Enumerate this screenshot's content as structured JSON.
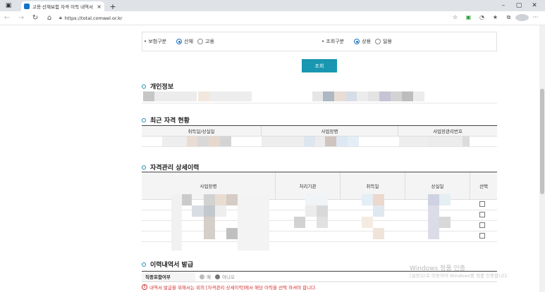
{
  "browser": {
    "tab_title": "고용·산재보험 자격 이력 내역서",
    "tab_close": "×",
    "new_tab": "+",
    "url": "https://total.comwel.or.kr",
    "win_controls": [
      "–",
      "▢",
      "✕"
    ],
    "icons": [
      "sidebar-icon",
      "back-icon",
      "forward-icon",
      "refresh-icon",
      "home-icon",
      "lock-icon",
      "favorite-add-icon",
      "extension-icon",
      "collections-icon",
      "favorites-icon",
      "browser-profile-icon",
      "more-icon"
    ]
  },
  "filters": {
    "insurance_label": "• 보험구분",
    "insurance_options": [
      "산재",
      "고용"
    ],
    "insurance_selected": "산재",
    "query_label": "• 조회구분",
    "query_options": [
      "상용",
      "일용"
    ],
    "query_selected": "상용",
    "search_button": "조회"
  },
  "personal": {
    "title": "개인정보"
  },
  "recent": {
    "title": "최근 자격 현황",
    "headers": [
      "취득일/상실일",
      "사업장명",
      "사업장관리번호"
    ]
  },
  "history": {
    "title": "자격관리 상세이력",
    "headers": [
      "사업장명",
      "처리기관",
      "취득일",
      "상실일",
      "선택"
    ],
    "row_count": 4
  },
  "issue": {
    "title": "이력내역서 발급",
    "field_label": "직종포함여부",
    "options": [
      "예",
      "아니오"
    ],
    "selected": "아니오",
    "warning": "내역서 발급을 위해서는 위의 [자격관리 상세이력]에서 해당 이력을 선택 하셔야 합니다."
  },
  "watermark": {
    "line1": "Windows 정품 인증",
    "line2": "[설정]으로 이동하여 Windows를 정품 인증합니다."
  },
  "colors": {
    "accent": "#1996b0",
    "radio": "#1b72c4",
    "warning": "#d43030"
  }
}
